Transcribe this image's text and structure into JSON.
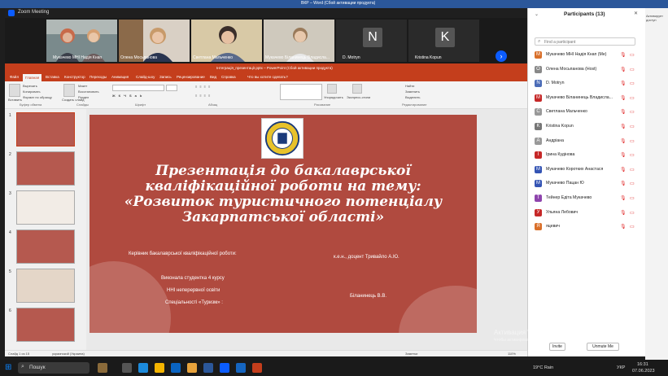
{
  "word": {
    "title": "ВКР – Word (Сбой активации продукта)",
    "side_text": "Активирует доступ"
  },
  "zoom": {
    "title": "Zoom Meeting",
    "tiles": [
      {
        "name": "Мукачево МНІ Надія Кнап"
      },
      {
        "name": "Олена Мосьпанова"
      },
      {
        "name": "Светлана Мальченко"
      },
      {
        "name": "Мукачево Біланинець Владисла..."
      },
      {
        "name": "D. Motryn",
        "initial": "N"
      },
      {
        "name": "Kristina Kopun",
        "initial": "K"
      }
    ],
    "next_icon": "chevron-right-icon"
  },
  "ppt": {
    "title": "Інтеграція_презентації.pptx – PowerPoint (Сбой активации продукта)",
    "tabs": [
      "Файл",
      "Главная",
      "Вставка",
      "Конструктор",
      "Переходы",
      "Анимация",
      "Слайд-шоу",
      "Запись",
      "Рецензирование",
      "Вид",
      "Справка",
      "Что вы хотите сделать?"
    ],
    "ribbon": {
      "paste": "Вставить",
      "cut": "Вырезать",
      "copy": "Копировать",
      "format_painter": "Формат по образцу",
      "new_slide": "Создать слайд",
      "layout": "Макет",
      "reset": "Восстановить",
      "section": "Раздел",
      "arrange": "Упорядочить",
      "quick_styles": "Экспресс-стили",
      "find": "Найти",
      "replace": "Заменить",
      "select": "Выделить",
      "groups": [
        "Буфер обмена",
        "Слайды",
        "Шрифт",
        "Абзац",
        "Рисование",
        "Редактирование"
      ]
    },
    "thumb_numbers": [
      "1",
      "2",
      "3",
      "4",
      "5",
      "6"
    ],
    "slide": {
      "title": "Презентація до бакалаврської кваліфікаційної роботи на тему: «Розвиток туристичного потенціалу Закарпатської області»",
      "supervisor_label": "Керівник бакалаврської кваліфікаційної роботи:",
      "supervisor_name": "к.е.н., доцент Тривайло А.Ю.",
      "student_line1": "Виконала студентка 4 курсу",
      "student_line2": "ННІ неперервної освіти",
      "student_line3": "Спеціальності «Туризм» :",
      "student_name": "Біланинець В.В."
    },
    "status": {
      "slide": "Слайд 1 из 15",
      "lang": "украинский (Украина)",
      "notes": "Заметки",
      "zoom": "110%"
    }
  },
  "participants": {
    "title": "Participants (13)",
    "search_placeholder": "Find a participant",
    "list": [
      {
        "name": "Мукачево МНІ Надія Кнап (Me)",
        "initial": "M",
        "color": "#d96f29"
      },
      {
        "name": "Олена Мосьпанова (Host)",
        "initial": "O",
        "color": "#888888"
      },
      {
        "name": "D. Motryn",
        "initial": "N",
        "color": "#4b6cb7"
      },
      {
        "name": "Мукачево Біланинець Владисла...",
        "initial": "M",
        "color": "#c62828"
      },
      {
        "name": "Светлана Мальченко",
        "initial": "C",
        "color": "#999999"
      },
      {
        "name": "Kristina Kopun",
        "initial": "K",
        "color": "#777777"
      },
      {
        "name": "Андріана",
        "initial": "A",
        "color": "#999999"
      },
      {
        "name": "Ірина Кудінова",
        "initial": "I",
        "color": "#c62828"
      },
      {
        "name": "Мукачево Коротких Анастася",
        "initial": "M",
        "color": "#3454b4"
      },
      {
        "name": "Мукачево Пацан Ю",
        "initial": "M",
        "color": "#3454b4"
      },
      {
        "name": "Тейнер Едіта Мукачево",
        "initial": "T",
        "color": "#8e44ad"
      },
      {
        "name": "Ульяна Лебович",
        "initial": "У",
        "color": "#c62828"
      },
      {
        "name": "яцевич",
        "initial": "Я",
        "color": "#d96f29"
      }
    ],
    "invite": "Invite",
    "mute_me": "Unmute Me"
  },
  "activation": {
    "title": "Активация Windows",
    "sub": "Чтобы активировать Windows, перейдите в раздел \"Параметры\"."
  },
  "taskbar": {
    "search": "Пошук",
    "weather": "19°C Rain",
    "lang": "УКР",
    "time": "16:31",
    "date": "07.06.2023"
  }
}
